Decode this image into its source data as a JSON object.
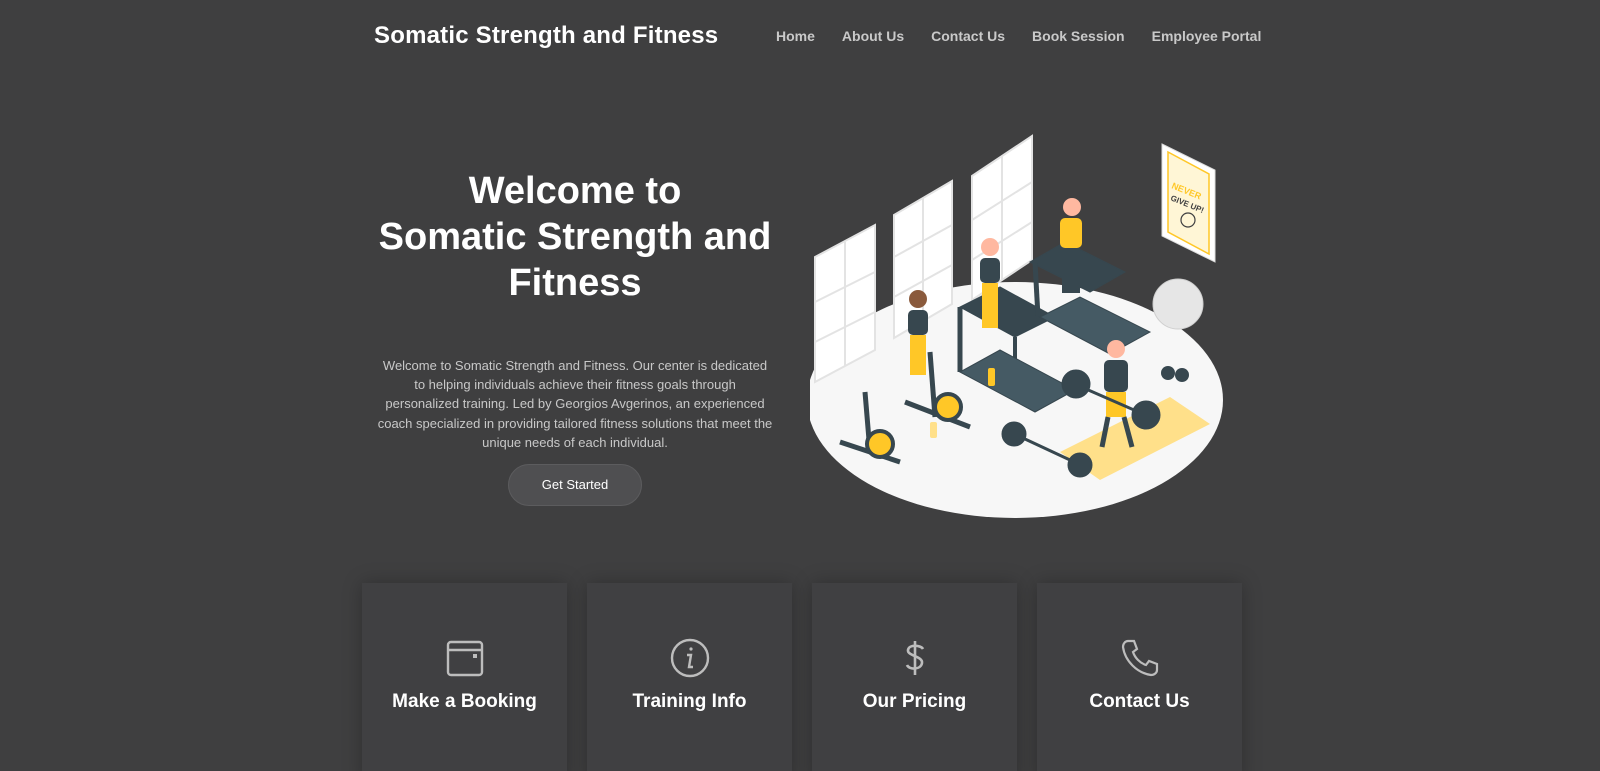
{
  "brand": {
    "name": "Somatic Strength and Fitness"
  },
  "nav": {
    "items": [
      {
        "label": "Home"
      },
      {
        "label": "About Us"
      },
      {
        "label": "Contact Us"
      },
      {
        "label": "Book Session"
      },
      {
        "label": "Employee Portal"
      }
    ]
  },
  "hero": {
    "title_line1": "Welcome to",
    "title_line2": "Somatic Strength and",
    "title_line3": "Fitness",
    "description": "Welcome to Somatic Strength and Fitness. Our center is dedicated to helping individuals achieve their fitness goals through personalized training. Led by Georgios Avgerinos, an experienced coach specialized in providing tailored fitness solutions that meet the unique needs of each individual.",
    "cta_label": "Get Started",
    "poster_text_1": "NEVER",
    "poster_text_2": "GIVE UP!"
  },
  "cards": [
    {
      "label": "Make a Booking",
      "icon": "calendar-icon"
    },
    {
      "label": "Training Info",
      "icon": "info-icon"
    },
    {
      "label": "Our Pricing",
      "icon": "dollar-icon"
    },
    {
      "label": "Contact Us",
      "icon": "phone-icon"
    }
  ],
  "colors": {
    "background": "#3f3f40",
    "accent_yellow": "#ffc727",
    "nav_text": "#c9c9c9",
    "icon_gray": "#bdbdbd"
  }
}
